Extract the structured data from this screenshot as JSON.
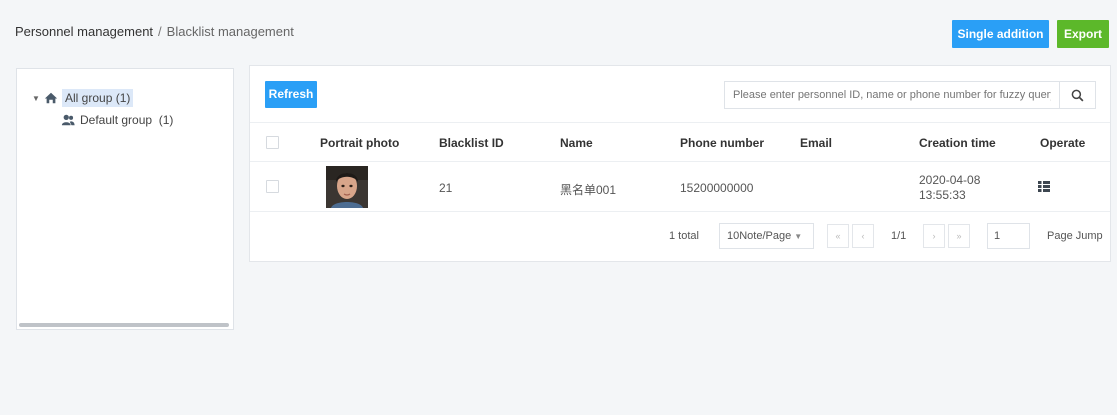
{
  "breadcrumb": {
    "parent": "Personnel management",
    "separator": "/",
    "current": "Blacklist management"
  },
  "header_buttons": {
    "single_addition": "Single addition",
    "export": "Export"
  },
  "tree": {
    "root": {
      "label": "All group",
      "count": "(1)",
      "icon": "home-icon",
      "expand_icon": "caret-down-icon"
    },
    "children": [
      {
        "label": "Default group",
        "count": "(1)",
        "icon": "group-icon"
      }
    ]
  },
  "toolbar": {
    "refresh": "Refresh",
    "search_placeholder": "Please enter personnel ID, name or phone number for fuzzy query",
    "search_icon": "search-icon"
  },
  "table": {
    "columns": [
      "Portrait photo",
      "Blacklist ID",
      "Name",
      "Phone number",
      "Email",
      "Creation time",
      "Operate"
    ],
    "rows": [
      {
        "blacklist_id": "21",
        "name": "黑名单001",
        "phone": "15200000000",
        "email": "",
        "creation_date": "2020-04-08",
        "creation_time": "13:55:33",
        "operate_icon": "detail-list-icon"
      }
    ]
  },
  "pager": {
    "total": "1 total",
    "page_size": "10Note/Page",
    "page_info": "1/1",
    "page_input": "1",
    "jump_label": "Page Jump"
  },
  "colors": {
    "primary": "#2a9ff6",
    "success": "#5cb82a",
    "background": "#f4f6f8",
    "selected_node": "#dce8f8"
  }
}
